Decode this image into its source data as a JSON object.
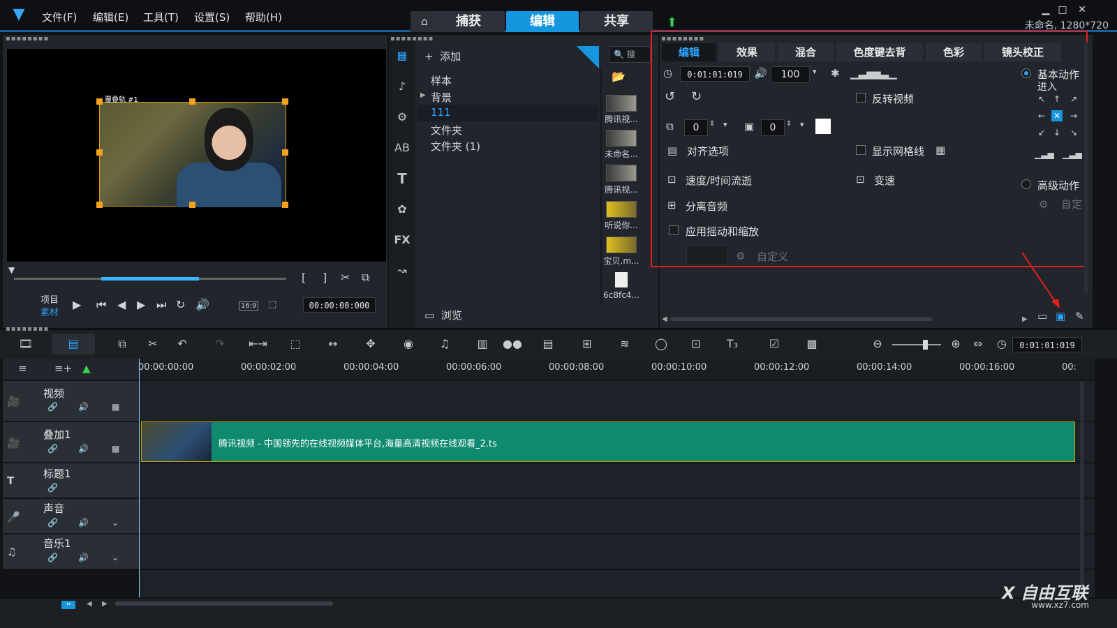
{
  "menu": [
    "文件(F)",
    "编辑(E)",
    "工具(T)",
    "设置(S)",
    "帮助(H)"
  ],
  "top_tabs": [
    "捕获",
    "编辑",
    "共享"
  ],
  "project_info": "未命名, 1280*720",
  "preview": {
    "clip_label": "覆叠轨 #1",
    "mode_project": "项目",
    "mode_clip": "素材",
    "aspect": "16:9",
    "timecode": "00:00:00:000"
  },
  "library": {
    "add_label": "添加",
    "folders": [
      "样本",
      "背景",
      "111",
      "文件夹",
      "文件夹 (1)"
    ],
    "selected_folder": "111",
    "browse_label": "浏览",
    "search_placeholder": "搜",
    "thumbs": [
      "腾讯视...",
      "未命名...",
      "腾讯视...",
      "听说你...",
      "宝贝.m...",
      "6c8fc4..."
    ]
  },
  "options": {
    "tabs": [
      "编辑",
      "效果",
      "混合",
      "色度键去背",
      "色彩",
      "镜头校正"
    ],
    "duration": "0:01:01:019",
    "volume": "100",
    "reverse_video": "反转视频",
    "offset_a": "0",
    "offset_b": "0",
    "align_options": "对齐选项",
    "show_grid": "显示网格线",
    "speed_time": "速度/时间流逝",
    "variable_speed": "变速",
    "split_audio": "分离音频",
    "pan_zoom": "应用摇动和缩放",
    "custom": "自定义",
    "basic_motion": "基本动作",
    "enter": "进入",
    "advanced_motion": "高级动作",
    "custom_adv": "自定"
  },
  "timeline": {
    "timecode": "0:01:01:019",
    "ruler": [
      "00:00:00:00",
      "00:00:02:00",
      "00:00:04:00",
      "00:00:06:00",
      "00:00:08:00",
      "00:00:10:00",
      "00:00:12:00",
      "00:00:14:00",
      "00:00:16:00",
      "00:"
    ],
    "tracks": [
      "视频",
      "叠加1",
      "标题1",
      "声音",
      "音乐1"
    ],
    "overlay_clip": "腾讯视频 - 中国领先的在线视频媒体平台,海量高清视频在线观看_2.ts"
  },
  "watermark": {
    "brand": "X 自由互联",
    "url": "www.xz7.com"
  },
  "colors": {
    "accent": "#1796e0",
    "highlight_box": "#e61e1e",
    "clip_green": "#0f8a6e"
  }
}
